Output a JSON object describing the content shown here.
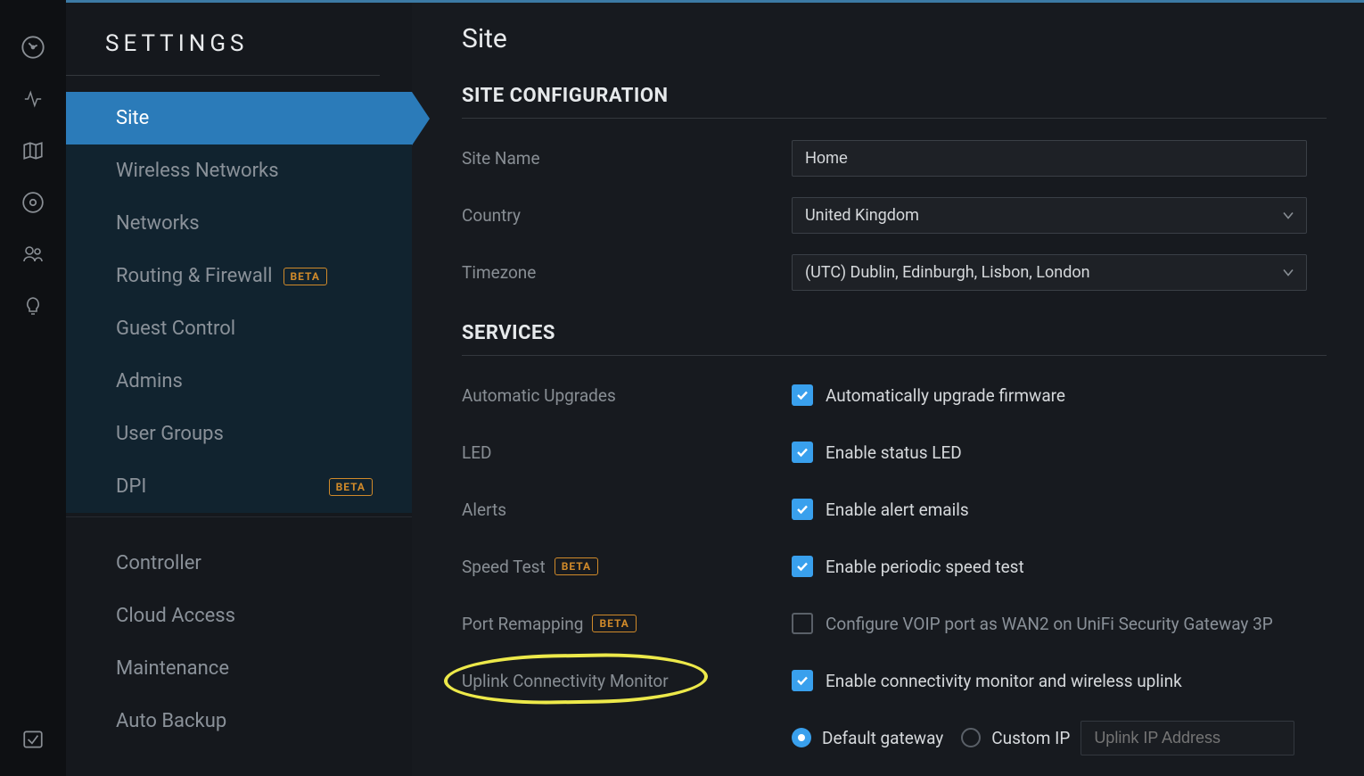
{
  "sidebar": {
    "title": "SETTINGS",
    "groups": [
      [
        {
          "label": "Site",
          "active": true,
          "beta": false
        },
        {
          "label": "Wireless Networks",
          "dark": true
        },
        {
          "label": "Networks",
          "dark": true
        },
        {
          "label": "Routing & Firewall",
          "dark": true,
          "beta": true
        },
        {
          "label": "Guest Control",
          "dark": true
        },
        {
          "label": "Admins",
          "dark": true
        },
        {
          "label": "User Groups",
          "dark": true
        },
        {
          "label": "DPI",
          "dark": true,
          "beta": true,
          "beta_push_right": true
        }
      ],
      [
        {
          "label": "Controller"
        },
        {
          "label": "Cloud Access"
        },
        {
          "label": "Maintenance"
        },
        {
          "label": "Auto Backup"
        }
      ]
    ]
  },
  "page": {
    "title": "Site"
  },
  "section_config": {
    "title": "SITE CONFIGURATION",
    "site_name": {
      "label": "Site Name",
      "value": "Home"
    },
    "country": {
      "label": "Country",
      "value": "United Kingdom"
    },
    "timezone": {
      "label": "Timezone",
      "value": "(UTC) Dublin, Edinburgh, Lisbon, London"
    }
  },
  "section_services": {
    "title": "SERVICES",
    "auto_upgrades": {
      "label": "Automatic Upgrades",
      "check_label": "Automatically upgrade firmware",
      "checked": true
    },
    "led": {
      "label": "LED",
      "check_label": "Enable status LED",
      "checked": true
    },
    "alerts": {
      "label": "Alerts",
      "check_label": "Enable alert emails",
      "checked": true
    },
    "speed_test": {
      "label": "Speed Test",
      "beta": true,
      "check_label": "Enable periodic speed test",
      "checked": true
    },
    "port_remap": {
      "label": "Port Remapping",
      "beta": true,
      "check_label": "Configure VOIP port as WAN2 on UniFi Security Gateway 3P",
      "checked": false
    },
    "uplink": {
      "label": "Uplink Connectivity Monitor",
      "check_label": "Enable connectivity monitor and wireless uplink",
      "checked": true,
      "radio_default": "Default gateway",
      "radio_custom": "Custom IP",
      "ip_placeholder": "Uplink IP Address"
    }
  },
  "beta_text": "BETA"
}
